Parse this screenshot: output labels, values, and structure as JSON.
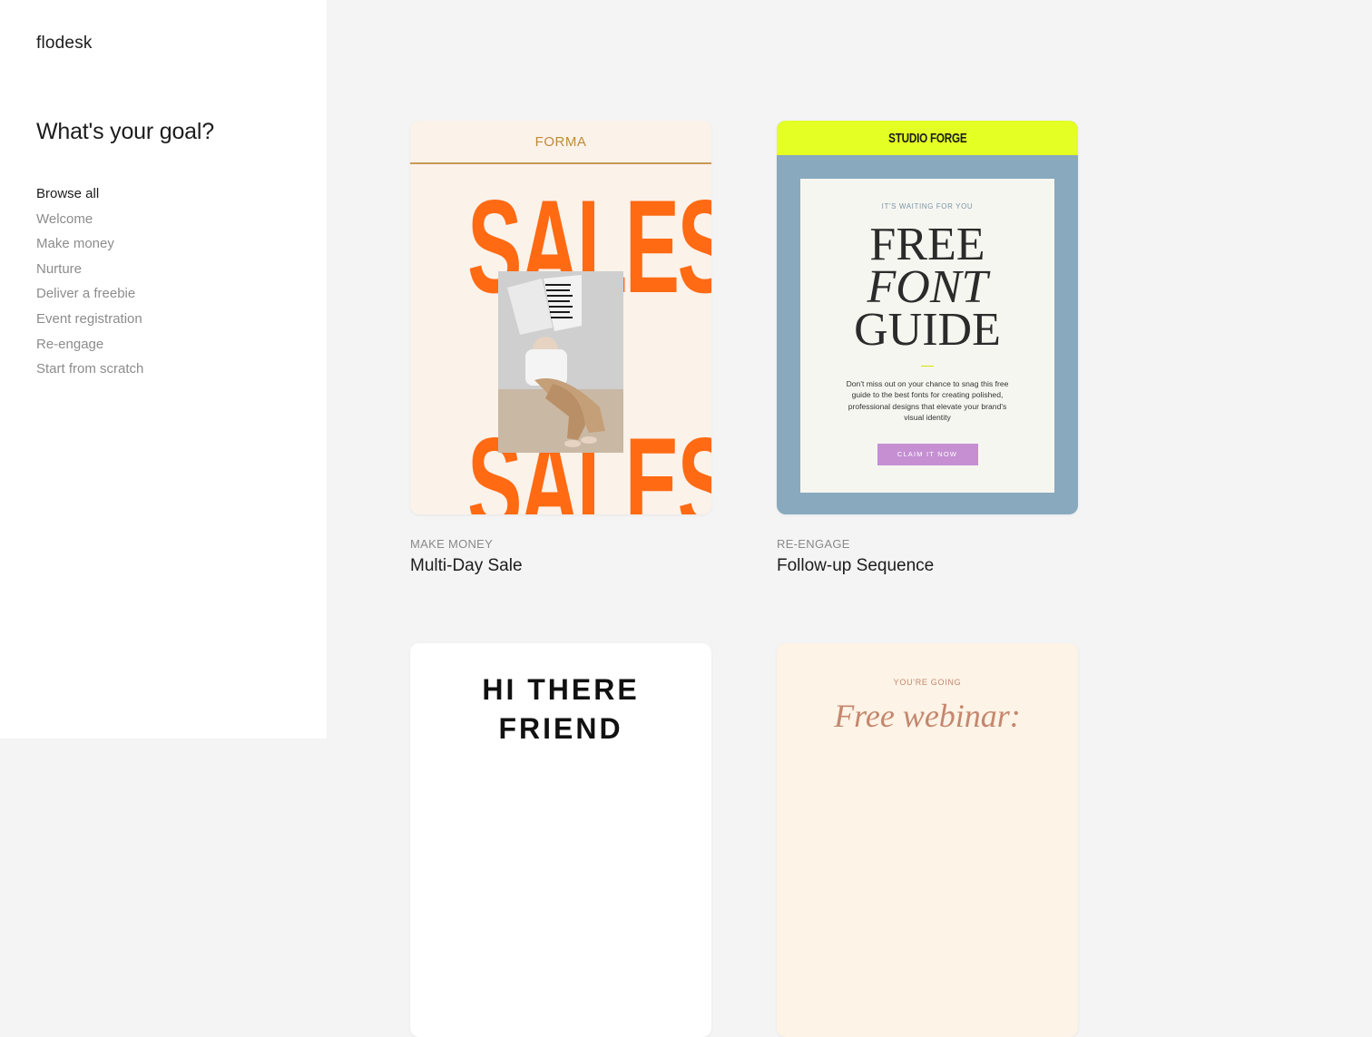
{
  "sidebar": {
    "logo": "flodesk",
    "title": "What's your goal?",
    "items": [
      {
        "label": "Browse all"
      },
      {
        "label": "Welcome"
      },
      {
        "label": "Make money"
      },
      {
        "label": "Nurture"
      },
      {
        "label": "Deliver a freebie"
      },
      {
        "label": "Event registration"
      },
      {
        "label": "Re-engage"
      },
      {
        "label": "Start from scratch"
      }
    ]
  },
  "templates": [
    {
      "category": "MAKE MONEY",
      "name": "Multi-Day Sale",
      "preview": {
        "brand": "FORMA",
        "headline": "SALESALE"
      }
    },
    {
      "category": "RE-ENGAGE",
      "name": "Follow-up Sequence",
      "preview": {
        "brand": "STUDIO FORGE",
        "kicker": "IT'S WAITING FOR YOU",
        "headline": [
          "FREE",
          "FONT",
          "GUIDE"
        ],
        "body": "Don't miss out on your chance to snag this free guide to the best fonts for creating polished, professional designs that elevate your brand's visual identity",
        "button": "CLAIM IT NOW"
      }
    },
    {
      "preview": {
        "headline": [
          "HI THERE",
          "FRIEND"
        ]
      }
    },
    {
      "preview": {
        "kicker": "YOU'RE GOING",
        "headline": "Free webinar:"
      }
    }
  ],
  "colors": {
    "sidebar_bg": "#ffffff",
    "page_bg": "#f4f4f4",
    "sale_orange": "#ff6a13",
    "forge_lime": "#e4ff24",
    "forge_blue": "#88a9be",
    "forge_button": "#c58fd2",
    "webinar_accent": "#c4876e"
  }
}
